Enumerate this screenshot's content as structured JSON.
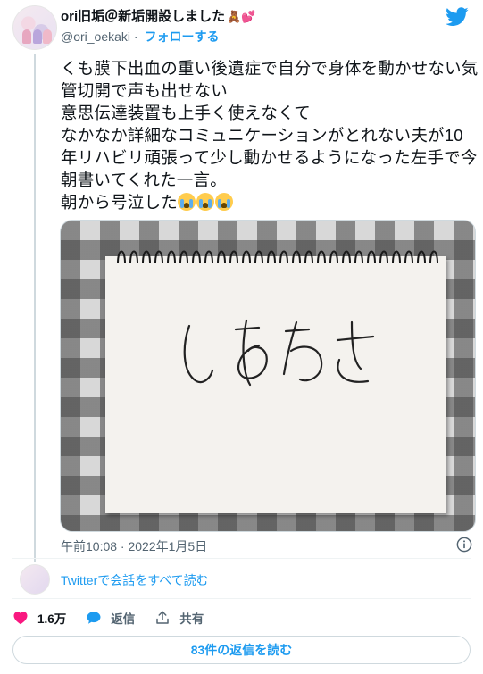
{
  "author": {
    "display_name": "ori旧垢＠新垢開設しました",
    "name_emojis": "🧸💕",
    "handle": "@ori_oekaki",
    "separator": "·",
    "follow_label": "フォローする"
  },
  "tweet": {
    "text": "くも膜下出血の重い後遺症で自分で身体を動かせない気管切開で声も出せない\n意思伝達装置も上手く使えなくて\nなかなか詳細なコミュニケーションがとれない夫が10年リハビリ頑張って少し動かせるようになった左手で今朝書いてくれた一言。\n朝から号泣した",
    "emoji_count": 3,
    "photo_handwriting": "しあわせ",
    "timestamp": "午前10:08 · 2022年1月5日"
  },
  "conversation_link": "Twitterで会話をすべて読む",
  "actions": {
    "like_count": "1.6万",
    "reply_label": "返信",
    "share_label": "共有"
  },
  "replies_button": "83件の返信を読む",
  "icons": {
    "twitter": "twitter-bird-icon",
    "info": "info-icon",
    "like": "heart-icon",
    "reply": "speech-bubble-icon",
    "share": "upload-icon",
    "crying": "loudly-crying-face-icon"
  },
  "colors": {
    "accent": "#1d9bf0",
    "like": "#f91880",
    "text": "#0f1419",
    "muted": "#536471"
  }
}
